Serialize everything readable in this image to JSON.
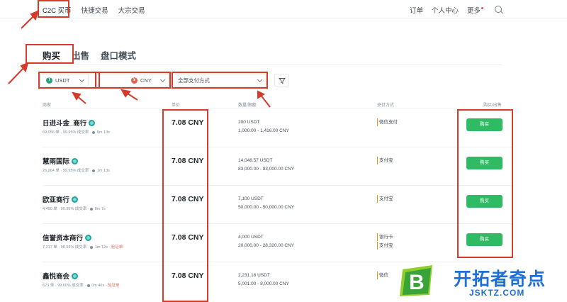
{
  "topnav": {
    "items": [
      "C2C 买币",
      "快捷交易",
      "大宗交易"
    ],
    "right": [
      "订单",
      "个人中心",
      "更多"
    ]
  },
  "tabs": [
    "购买",
    "出售",
    "盘口模式"
  ],
  "filters": {
    "asset": "USDT",
    "amount_placeholder": "",
    "fiat": "CNY",
    "payment": "全部支付方式"
  },
  "table": {
    "headers": [
      "商家",
      "单价",
      "数量/限额",
      "支付方式",
      "购买/出售"
    ],
    "rows": [
      {
        "name": "日进斗金_商行",
        "stats": "69,056 单 · 99.95% 成交率 · ",
        "time": "0m 13s",
        "extra": "",
        "price": "7.08 CNY",
        "amount": "200 USDT",
        "limit": "1,000.00 - 1,416.00 CNY",
        "payments": [
          "微信支付"
        ],
        "button": "购买"
      },
      {
        "name": "慧雨国际",
        "stats": "26,264 单 · 99.95% 成交率 · ",
        "time": "1m 13s",
        "extra": "",
        "price": "7.08 CNY",
        "amount": "14,048.57 USDT",
        "limit": "83,000.00 - 83,000.00 CNY",
        "payments": [
          "支付宝"
        ],
        "button": "购买"
      },
      {
        "name": "欧亚商行",
        "stats": "4,490 单 · 99.95% 成交率 · ",
        "time": "8m 7s",
        "extra": "",
        "price": "7.08 CNY",
        "amount": "7,100 USDT",
        "limit": "50,000.00 - 50,000.00 CNY",
        "payments": [
          "支付宝"
        ],
        "button": "购买"
      },
      {
        "name": "信誉资本商行",
        "stats": "7,217 单 · 98.93% 成交率 · ",
        "time": "1m 12s",
        "extra": "验证单",
        "price": "7.08 CNY",
        "amount": "4,000 USDT",
        "limit": "20,000.00 - 28,320.00 CNY",
        "payments": [
          "银行卡",
          "支付宝"
        ],
        "button": "购买"
      },
      {
        "name": "鑫悦商会",
        "stats": "623 单 · 99.60% 成交率 · ",
        "time": "0m 46s",
        "extra": "验证单",
        "price": "7.08 CNY",
        "amount": "2,231.18 USDT",
        "limit": "5,001.00 - 8,000.00 CNY",
        "payments": [
          "微信"
        ],
        "button": "购买"
      }
    ]
  },
  "watermark": {
    "mark_letter": "B",
    "title": "开拓者奇点",
    "subtitle": "JSKTZ.COM"
  },
  "colors": {
    "highlight": "#d53a2b",
    "buy_green": "#2fba64",
    "text": "#1e2329",
    "logo_blue": "#1e6fd6"
  }
}
